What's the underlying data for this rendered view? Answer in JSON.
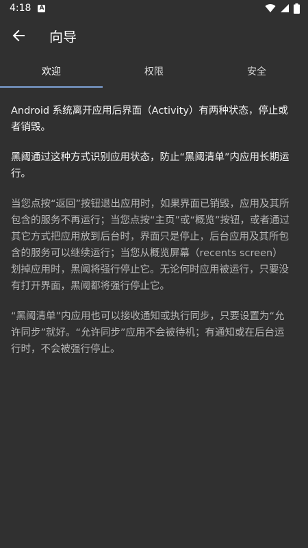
{
  "status_bar": {
    "time": "4:18",
    "notification_icon": "A"
  },
  "app_bar": {
    "title": "向导",
    "back_icon": "arrow-left-icon"
  },
  "tabs": [
    {
      "label": "欢迎",
      "active": true
    },
    {
      "label": "权限",
      "active": false
    },
    {
      "label": "安全",
      "active": false
    }
  ],
  "content": {
    "paragraphs": [
      "Android 系统离开应用后界面（Activity）有两种状态，停止或者销毁。",
      "黑阈通过这种方式识别应用状态，防止“黑阈清单”内应用长期运行。",
      "当您点按“返回”按钮退出应用时，如果界面已销毁，应用及其所包含的服务不再运行；当您点按“主页”或“概览”按钮，或者通过其它方式把应用放到后台时，界面只是停止，后台应用及其所包含的服务可以继续运行；当您从概览屏幕（recents screen）划掉应用时，黑阈将强行停止它。无论何时应用被运行，只要没有打开界面，黑阈都将强行停止它。",
      "“黑阈清单”内应用也可以接收通知或执行同步，只要设置为“允许同步”就好。“允许同步”应用不会被待机；有通知或在后台运行时，不会被强行停止。"
    ]
  },
  "colors": {
    "background": "#303030",
    "tab_indicator": "#7fa3d8",
    "secondary_text": "#b5b5b5"
  }
}
